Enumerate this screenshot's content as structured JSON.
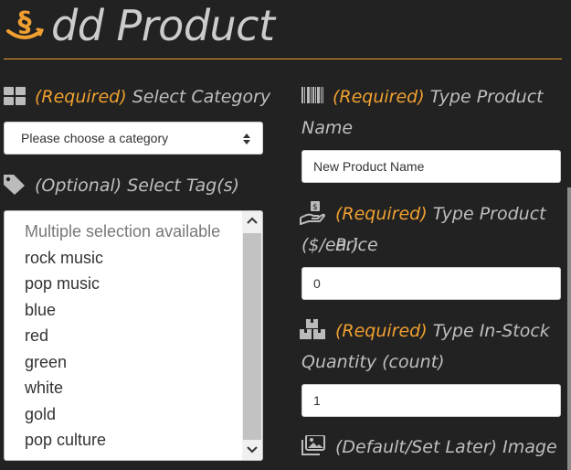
{
  "page": {
    "title": "dd Product",
    "logo_glyph": "§",
    "accent": "#f0a030"
  },
  "category": {
    "required": "(Required)",
    "label": "Select Category",
    "icon": "grid-icon",
    "selected": "Please choose a category"
  },
  "tags": {
    "optional": "(Optional)",
    "label": "Select Tag(s)",
    "icon": "tag-icon",
    "options": [
      "Multiple selection available",
      "rock music",
      "pop music",
      "blue",
      "red",
      "green",
      "white",
      "gold",
      "pop culture"
    ]
  },
  "name": {
    "required": "(Required)",
    "label_line1": "Type Product",
    "label_line2": "Name",
    "icon": "barcode-icon",
    "value": "New Product Name"
  },
  "price": {
    "required": "(Required)",
    "label_line1": "Type Product Price",
    "label_line2": "($/ea.)",
    "icon": "money-hand-icon",
    "value": "0"
  },
  "stock": {
    "required": "(Required)",
    "label_line1": "Type In-Stock",
    "label_line2": "Quantity (count)",
    "icon": "boxes-icon",
    "value": "1"
  },
  "image": {
    "default": "(Default/Set Later)",
    "label": "Image",
    "icon": "images-icon"
  }
}
